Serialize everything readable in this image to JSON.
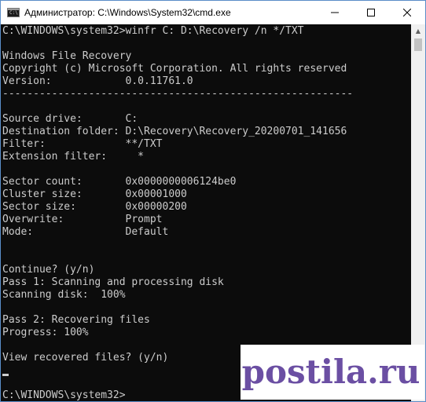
{
  "window": {
    "title": "Администратор: C:\\Windows\\System32\\cmd.exe",
    "icon": "cmd-icon"
  },
  "console": {
    "lines": [
      "C:\\WINDOWS\\system32>winfr C: D:\\Recovery /n */TXT",
      "",
      "Windows File Recovery",
      "Copyright (c) Microsoft Corporation. All rights reserved",
      "Version:            0.0.11761.0",
      "---------------------------------------------------------",
      "",
      "Source drive:       C:",
      "Destination folder: D:\\Recovery\\Recovery_20200701_141656",
      "Filter:             **/TXT",
      "Extension filter:     *",
      "",
      "Sector count:       0x0000000006124be0",
      "Cluster size:       0x00001000",
      "Sector size:        0x00000200",
      "Overwrite:          Prompt",
      "Mode:               Default",
      "",
      "",
      "Continue? (y/n)",
      "Pass 1: Scanning and processing disk",
      "Scanning disk:  100%",
      "",
      "Pass 2: Recovering files",
      "Progress: 100%",
      "",
      "View recovered files? (y/n)",
      "",
      "",
      "C:\\WINDOWS\\system32>"
    ]
  },
  "watermark": {
    "text": "postila.ru"
  }
}
